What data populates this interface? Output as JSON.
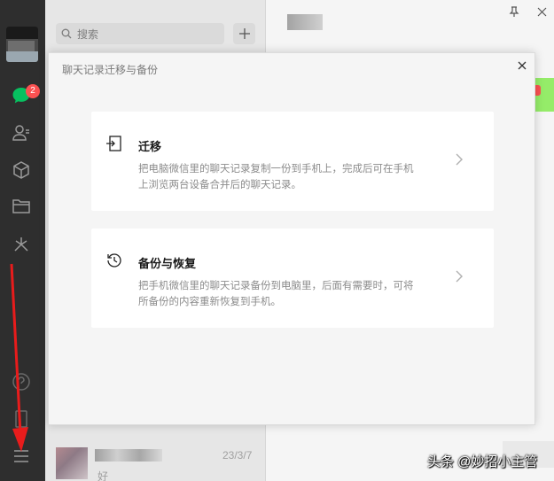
{
  "sidebar": {
    "chat_badge": "2",
    "icons": [
      "chat-icon",
      "contacts-icon",
      "favorites-icon",
      "files-icon",
      "moments-icon",
      "mini-program-icon",
      "phone-icon",
      "menu-icon"
    ]
  },
  "chatlist": {
    "search_placeholder": "搜索",
    "add_label": "+",
    "items": [
      {
        "date": "23/3/7",
        "preview": "好"
      }
    ]
  },
  "modal": {
    "title": "聊天记录迁移与备份",
    "options": [
      {
        "title": "迁移",
        "description": "把电脑微信里的聊天记录复制一份到手机上，完成后可在手机上浏览两台设备合并后的聊天记录。",
        "icon": "migrate-icon"
      },
      {
        "title": "备份与恢复",
        "description": "把手机微信里的聊天记录备份到电脑里，后面有需要时，可将所备份的内容重新恢复到手机。",
        "icon": "backup-restore-icon"
      }
    ]
  },
  "watermark": "头条 @妙招小主管",
  "colors": {
    "sidebar_bg": "#2e2e2e",
    "badge": "#fa5151",
    "accent_green": "#95ec69",
    "annotation_arrow": "#e81c1c"
  }
}
